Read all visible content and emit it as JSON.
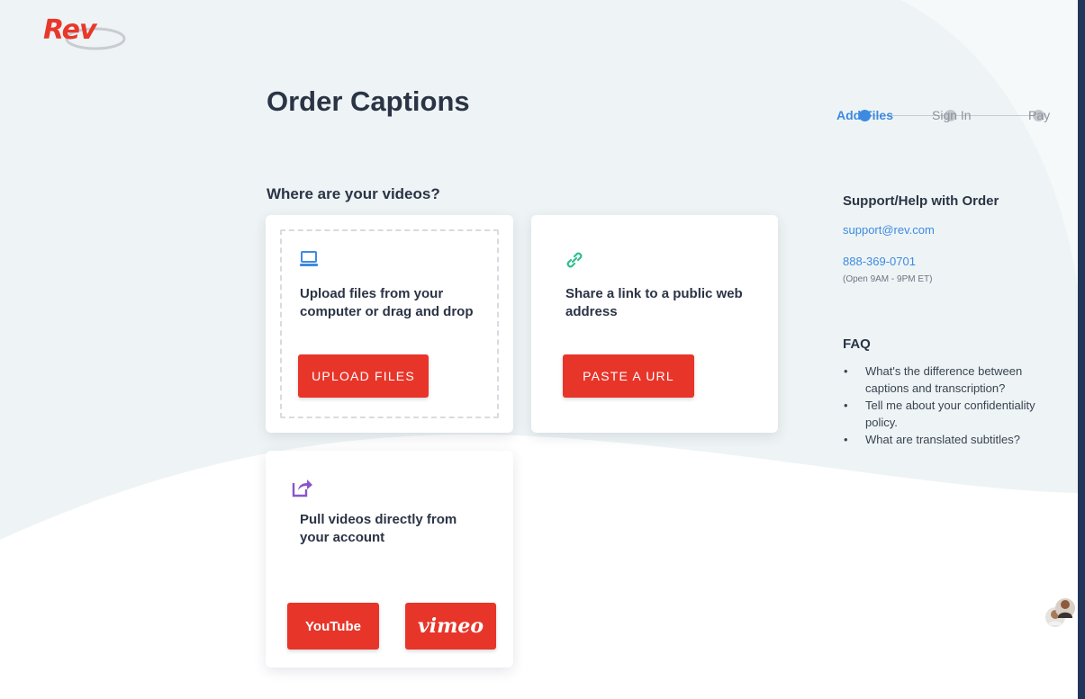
{
  "brand": {
    "logo_text": "Rev",
    "accent": "#e8352a",
    "link_color": "#3e8ae1"
  },
  "page": {
    "title": "Order Captions"
  },
  "stepper": {
    "steps": [
      {
        "label": "Add Files",
        "state": "active"
      },
      {
        "label": "Sign In",
        "state": "inactive"
      },
      {
        "label": "Pay",
        "state": "inactive"
      }
    ]
  },
  "sources": {
    "heading": "Where are your videos?",
    "upload": {
      "icon": "laptop-icon",
      "text": "Upload files from your computer or drag and drop",
      "button": "UPLOAD FILES"
    },
    "link": {
      "icon": "link-icon",
      "text": "Share a link to a public web address",
      "button": "PASTE A URL"
    },
    "account": {
      "icon": "share-icon",
      "text": "Pull videos directly from your account",
      "youtube_label": "YouTube",
      "vimeo_label": "vimeo"
    }
  },
  "support": {
    "heading": "Support/Help with Order",
    "email": "support@rev.com",
    "phone": "888-369-0701",
    "hours": "(Open 9AM - 9PM ET)"
  },
  "faq": {
    "heading": "FAQ",
    "items": [
      "What's the difference between captions and transcription?",
      "Tell me about your confidentiality policy.",
      "What are translated subtitles?"
    ]
  }
}
